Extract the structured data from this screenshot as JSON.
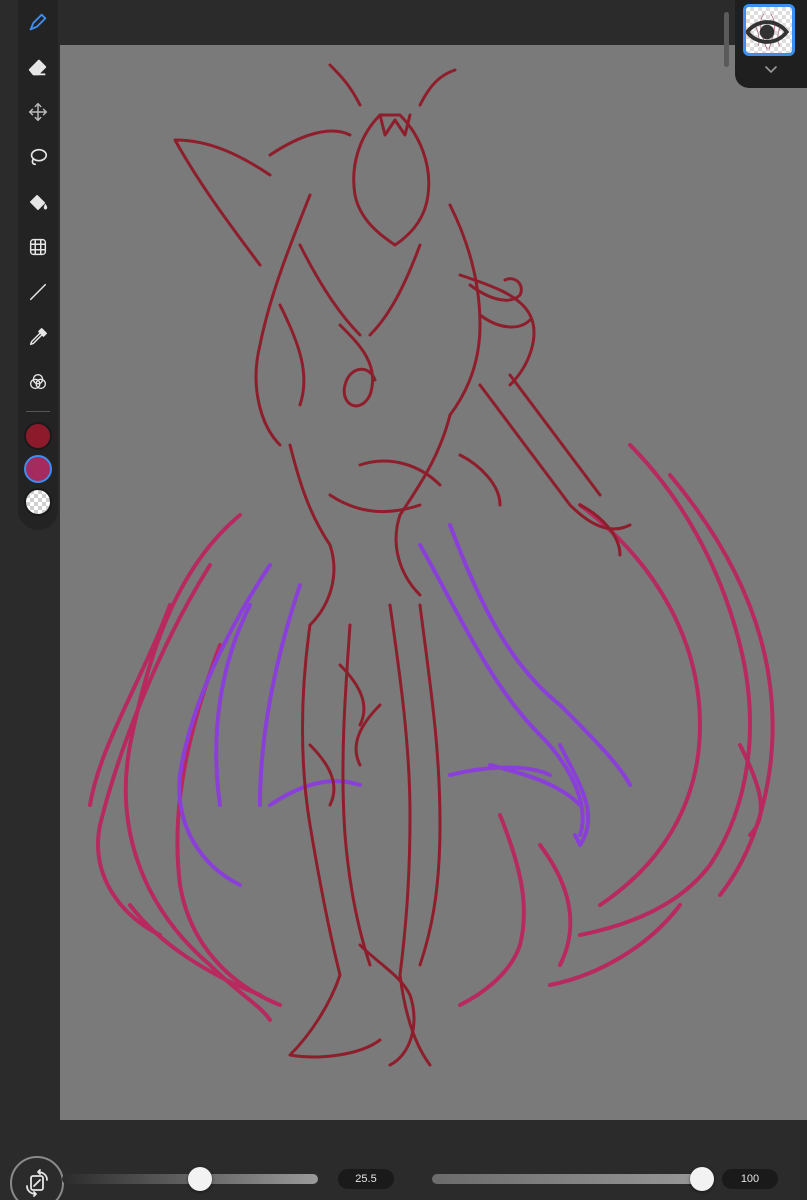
{
  "toolbar": {
    "tools": [
      {
        "id": "brush",
        "icon": "brush-icon",
        "active": true
      },
      {
        "id": "eraser",
        "icon": "eraser-icon"
      },
      {
        "id": "move",
        "icon": "move-icon"
      },
      {
        "id": "lasso",
        "icon": "lasso-icon"
      },
      {
        "id": "fill",
        "icon": "fill-bucket-icon"
      },
      {
        "id": "transform",
        "icon": "transform-icon"
      },
      {
        "id": "line",
        "icon": "line-icon"
      },
      {
        "id": "eyedropper",
        "icon": "eyedropper-icon"
      },
      {
        "id": "blend",
        "icon": "blend-modes-icon"
      }
    ],
    "colors": {
      "primary": "#8c1a2b",
      "secondary": "#a52a5d",
      "tertiary": "transparent"
    }
  },
  "canvas": {
    "background": "#7a7a7a",
    "stroke_colors": {
      "dark_red": "#8e1e2c",
      "magenta": "#b8295f",
      "violet": "#8a3fd8"
    }
  },
  "bottom": {
    "brush_size": "25.5",
    "brush_size_fraction": 0.54,
    "opacity": "100",
    "opacity_fraction": 1.0
  },
  "accent_color": "#3d8ef0"
}
